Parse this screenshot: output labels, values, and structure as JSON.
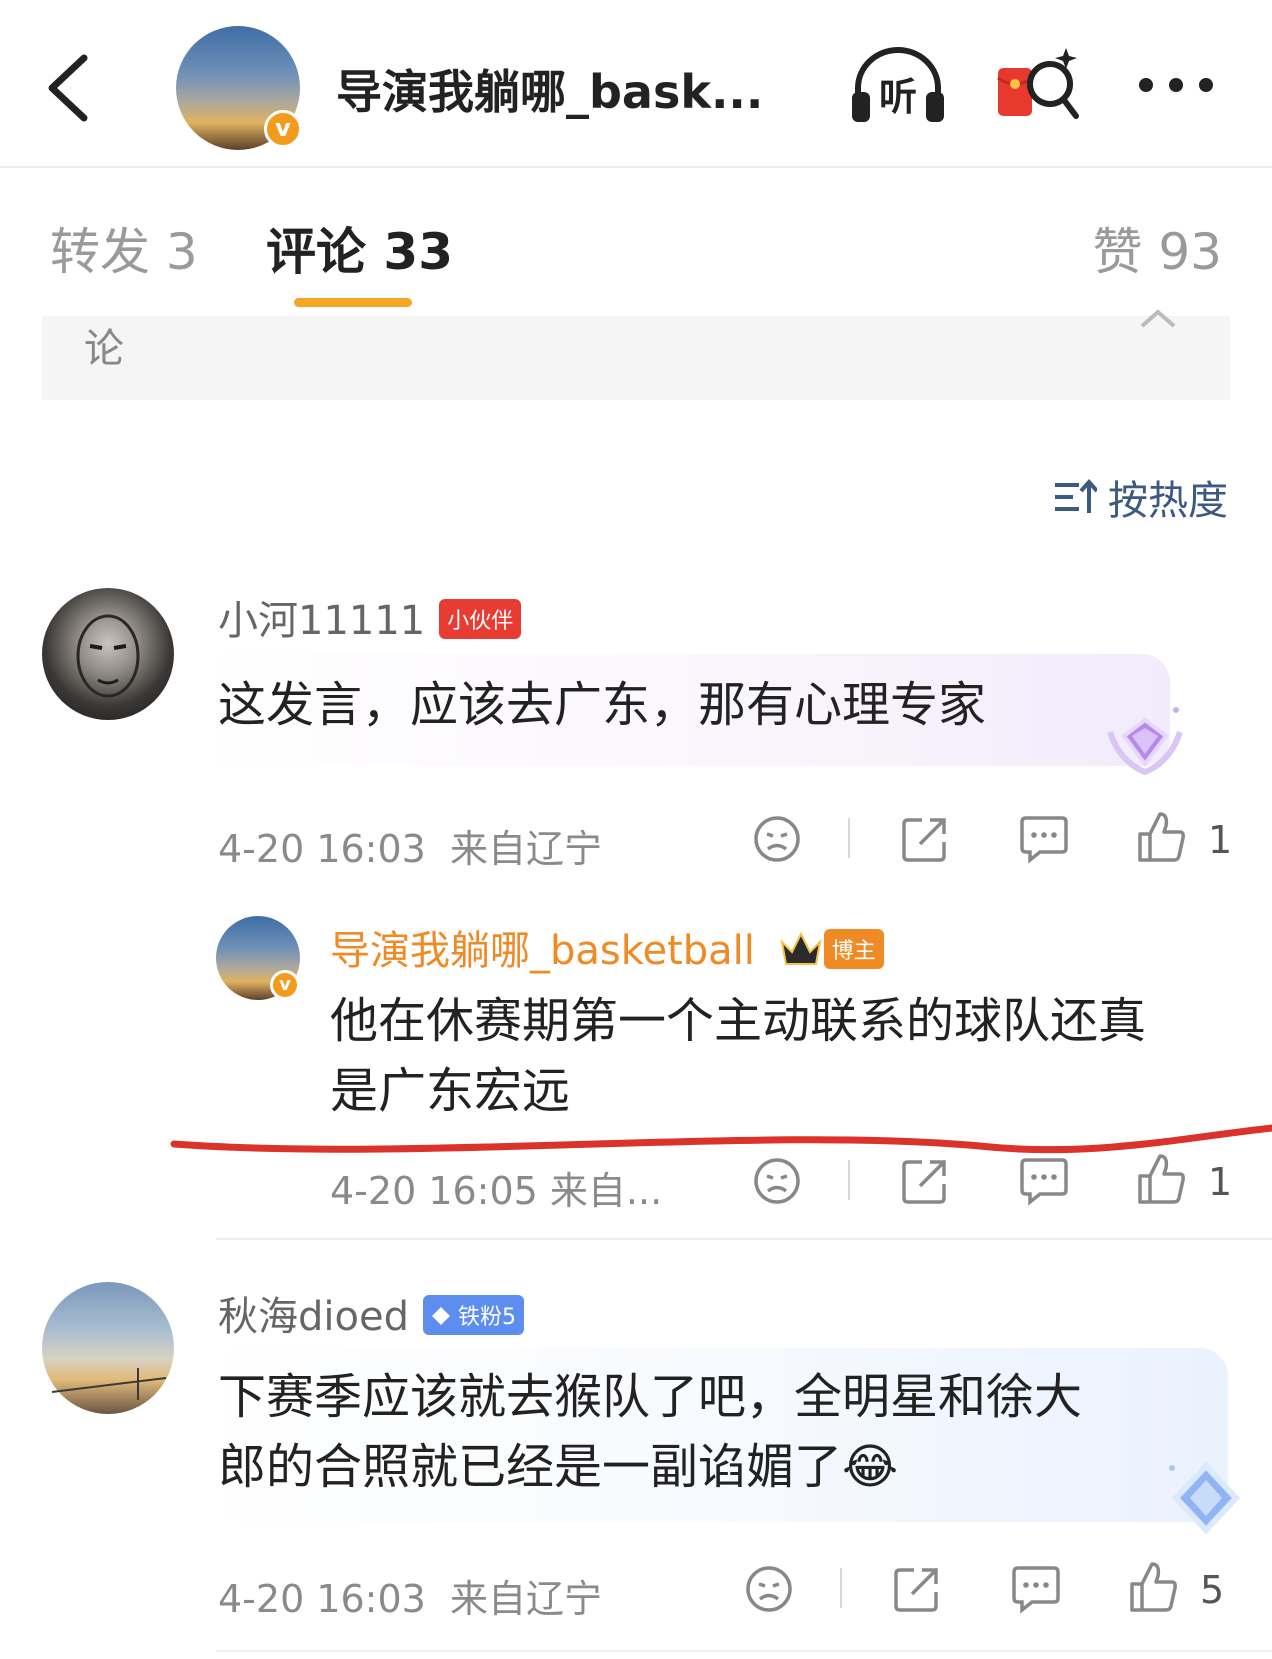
{
  "header": {
    "title": "导演我躺哪_bask...",
    "verified_badge": "v",
    "listen_label": "听"
  },
  "tabs": [
    {
      "label": "转发 3"
    },
    {
      "label": "评论 33"
    },
    {
      "label": "赞 93"
    }
  ],
  "fold_bar": {
    "text": "论"
  },
  "sort": {
    "label": "按热度",
    "icon": "sort-icon"
  },
  "comments": [
    {
      "user": "小河11111",
      "tag": "小伙伴",
      "text": "这发言，应该去广东，那有心理专家",
      "date": "4-20 16:03",
      "location": "来自辽宁",
      "likes": "1"
    },
    {
      "user": "导演我躺哪_basketball",
      "tag": "博主",
      "verified_badge": "v",
      "text_lines": [
        "他在休赛期第一个主动联系的球队还真",
        "是广东宏远"
      ],
      "meta": "4-20 16:05 来自...",
      "likes": "1"
    },
    {
      "user": "秋海dioed",
      "tag": "铁粉5",
      "text_lines": [
        "下赛季应该就去猴队了吧，全明星和徐大",
        "郎的合照就已经是一副谄媚了😂"
      ],
      "date": "4-20 16:03",
      "location": "来自辽宁",
      "likes": "5"
    }
  ],
  "colors": {
    "accent": "#f5a623",
    "tag_red": "#e83b32",
    "tag_blue": "#5e8df0",
    "author_orange": "#f08a24",
    "annotation_red": "#d9332b"
  }
}
